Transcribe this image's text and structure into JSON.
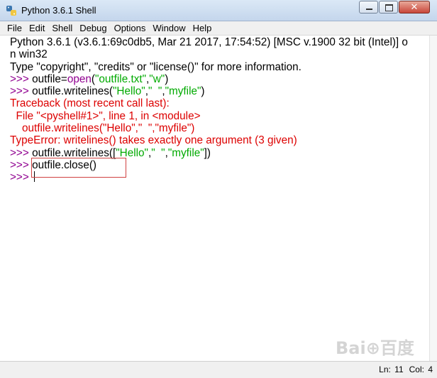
{
  "window": {
    "title": "Python 3.6.1 Shell",
    "close_glyph": "✕"
  },
  "menu": [
    "File",
    "Edit",
    "Shell",
    "Debug",
    "Options",
    "Window",
    "Help"
  ],
  "shell": {
    "banner1": "Python 3.6.1 (v3.6.1:69c0db5, Mar 21 2017, 17:54:52) [MSC v.1900 32 bit (Intel)] o",
    "banner2": "n win32",
    "banner3": "Type \"copyright\", \"credits\" or \"license()\" for more information.",
    "prompt": ">>> ",
    "cmd1": {
      "a": "outfile=",
      "b": "open",
      "c": "(",
      "d": "\"outfile.txt\"",
      "e": ",",
      "f": "\"w\"",
      "g": ")"
    },
    "cmd2": {
      "a": "outfile.writelines(",
      "b": "\"Hello\"",
      "c": ",",
      "d": "\"  \"",
      "e": ",",
      "f": "\"myfile\"",
      "g": ")"
    },
    "tb1": "Traceback (most recent call last):",
    "tb2": "  File \"<pyshell#1>\", line 1, in <module>",
    "tb3": "    outfile.writelines(\"Hello\",\"  \",\"myfile\")",
    "tb4": "TypeError: writelines() takes exactly one argument (3 given)",
    "cmd3": {
      "a": "outfile.writelines([",
      "b": "\"Hello\"",
      "c": ",",
      "d": "\"  \"",
      "e": ",",
      "f": "\"myfile\"",
      "g": "])"
    },
    "cmd4": "outfile.close()"
  },
  "status": {
    "ln": "Ln: 11",
    "col": "Col: 4"
  },
  "watermark": "Bai⊕百度"
}
